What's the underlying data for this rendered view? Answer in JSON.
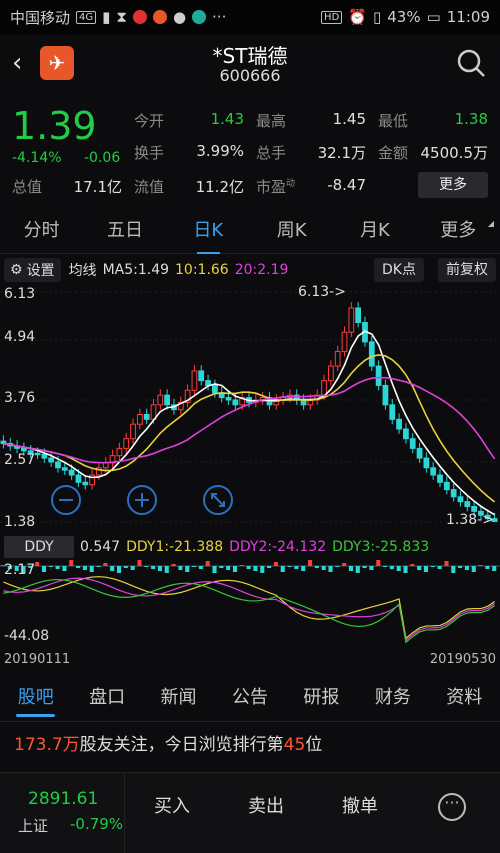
{
  "status": {
    "carrier": "中国移动",
    "net": "4G",
    "battery": "43%",
    "time": "11:09",
    "hd": "HD"
  },
  "header": {
    "title": "*ST瑞德",
    "code": "600666"
  },
  "quote": {
    "price": "1.39",
    "change_pct": "-4.14%",
    "change": "-0.06",
    "open_label": "今开",
    "open": "1.43",
    "high_label": "最高",
    "high": "1.45",
    "low_label": "最低",
    "low": "1.38",
    "turnover_label": "换手",
    "turnover": "3.99%",
    "volume_label": "总手",
    "volume": "32.1万",
    "amount_label": "金额",
    "amount": "4500.5万",
    "mktcap_label": "总值",
    "mktcap": "17.1亿",
    "float_label": "流值",
    "float": "11.2亿",
    "pe_label": "市盈",
    "pe_sup": "动",
    "pe": "-8.47",
    "more_label": "更多"
  },
  "tabs": [
    "分时",
    "五日",
    "日K",
    "周K",
    "月K",
    "更多"
  ],
  "active_tab": "日K",
  "ma": {
    "settings_label": "设置",
    "ma_label": "均线",
    "ma5": "MA5:1.49",
    "ma10": "10:1.66",
    "ma20": "20:2.19",
    "dk_label": "DK点",
    "fq_label": "前复权"
  },
  "chart_axis": {
    "y_top": "6.13",
    "y_2": "4.94",
    "y_3": "3.76",
    "y_4": "2.57",
    "y_bottom": "1.38",
    "high_marker": "6.13->",
    "low_marker": "1.38->"
  },
  "ddy": {
    "button": "DDY",
    "value": "0.547",
    "ddy1": "DDY1:-21.388",
    "ddy2": "DDY2:-24.132",
    "ddy3": "DDY3:-25.833",
    "y_top": "2.17",
    "y_bottom": "-44.08"
  },
  "dates": {
    "start": "20190111",
    "end": "20190530"
  },
  "bottom_tabs": [
    "股吧",
    "盘口",
    "新闻",
    "公告",
    "研报",
    "财务",
    "资料"
  ],
  "follow": {
    "count": "173.7万",
    "text1": "股友关注，今日浏览排行第",
    "rank": "45",
    "text2": "位"
  },
  "index": {
    "value": "2891.61",
    "name": "上证",
    "pct": "-0.79%"
  },
  "actions": {
    "buy": "买入",
    "sell": "卖出",
    "cancel": "撤单"
  },
  "chart_data": {
    "type": "candlestick",
    "xlabel": "",
    "ylabel": "",
    "ylim": [
      1.38,
      6.13
    ],
    "x_range": [
      "20190111",
      "20190530"
    ],
    "close": [
      3.0,
      2.95,
      2.9,
      2.85,
      2.8,
      2.78,
      2.7,
      2.62,
      2.5,
      2.45,
      2.35,
      2.2,
      2.15,
      2.35,
      2.5,
      2.6,
      2.75,
      2.9,
      3.1,
      3.4,
      3.6,
      3.5,
      3.8,
      4.0,
      3.8,
      3.7,
      3.85,
      4.1,
      4.5,
      4.3,
      4.2,
      4.05,
      3.95,
      3.9,
      3.8,
      3.95,
      3.85,
      3.9,
      3.95,
      3.8,
      3.9,
      3.95,
      4.0,
      3.9,
      3.8,
      3.9,
      4.0,
      4.3,
      4.6,
      4.9,
      5.3,
      5.8,
      5.5,
      5.1,
      4.6,
      4.2,
      3.8,
      3.5,
      3.3,
      3.1,
      2.9,
      2.7,
      2.5,
      2.35,
      2.2,
      2.05,
      1.9,
      1.8,
      1.7,
      1.6,
      1.52,
      1.45,
      1.39
    ],
    "series": [
      {
        "name": "MA5",
        "last": 1.49
      },
      {
        "name": "MA10",
        "last": 1.66
      },
      {
        "name": "MA20",
        "last": 2.19
      }
    ]
  }
}
